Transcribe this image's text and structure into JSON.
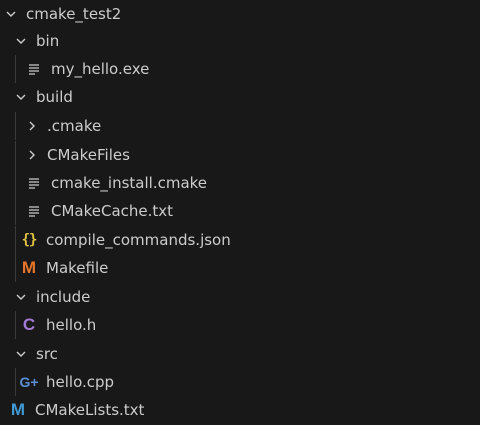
{
  "explorer": {
    "root": {
      "label": "cmake_test2",
      "expanded": true
    },
    "rows": [
      {
        "id": "bin",
        "label": "bin",
        "type": "folder",
        "expanded": true
      },
      {
        "id": "my_hello",
        "label": "my_hello.exe",
        "type": "file",
        "icon": "lines-icon"
      },
      {
        "id": "build",
        "label": "build",
        "type": "folder",
        "expanded": true
      },
      {
        "id": "dotcmake",
        "label": ".cmake",
        "type": "folder",
        "expanded": false
      },
      {
        "id": "cmakefiles",
        "label": "CMakeFiles",
        "type": "folder",
        "expanded": false
      },
      {
        "id": "cmake_install",
        "label": "cmake_install.cmake",
        "type": "file",
        "icon": "lines-icon"
      },
      {
        "id": "cmakecache",
        "label": "CMakeCache.txt",
        "type": "file",
        "icon": "lines-icon"
      },
      {
        "id": "compile_commands",
        "label": "compile_commands.json",
        "type": "file",
        "icon": "json-braces-icon",
        "icon_glyph": "{}"
      },
      {
        "id": "makefile",
        "label": "Makefile",
        "type": "file",
        "icon": "makefile-m-icon",
        "icon_glyph": "M"
      },
      {
        "id": "include",
        "label": "include",
        "type": "folder",
        "expanded": true
      },
      {
        "id": "hello_h",
        "label": "hello.h",
        "type": "file",
        "icon": "c-header-icon",
        "icon_glyph": "C"
      },
      {
        "id": "src",
        "label": "src",
        "type": "folder",
        "expanded": true
      },
      {
        "id": "hello_cpp",
        "label": "hello.cpp",
        "type": "file",
        "icon": "cpp-icon",
        "icon_glyph": "G+"
      },
      {
        "id": "cmakelists",
        "label": "CMakeLists.txt",
        "type": "file",
        "icon": "cmake-m-icon",
        "icon_glyph": "M"
      }
    ]
  },
  "colors": {
    "background": "#181818",
    "text": "#cccccc",
    "indent_guide": "#3a3a3a",
    "json_icon": "#e0c341",
    "makefile_icon": "#e8752a",
    "cmake_icon": "#3f9ad6",
    "c_header_icon": "#a379d6",
    "cpp_icon": "#5a8fd6"
  }
}
